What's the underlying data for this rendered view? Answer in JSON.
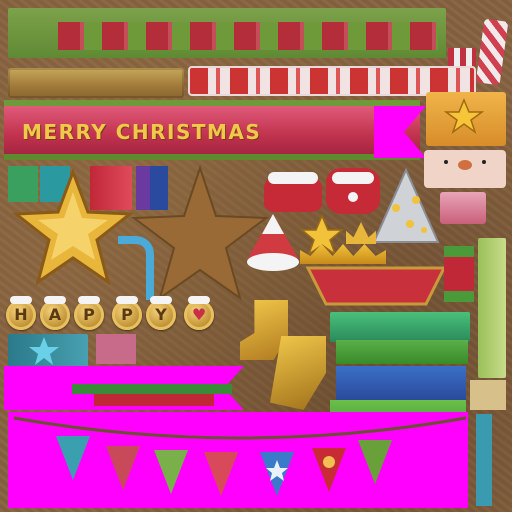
{
  "banner": {
    "text": "MERRY CHRISTMAS"
  },
  "coins": [
    "H",
    "A",
    "P",
    "P",
    "Y",
    "♥"
  ],
  "colors": {
    "magenta": "#ff00ff",
    "christmas_red": "#c2334f",
    "christmas_green": "#6f9a3a",
    "gold": "#e8b63a",
    "wood": "#86623f"
  },
  "icons": [
    "star-icon",
    "santa-hat-icon",
    "crown-icon",
    "snowman-face-icon",
    "party-hat-icon",
    "bunting-flag-icon"
  ]
}
